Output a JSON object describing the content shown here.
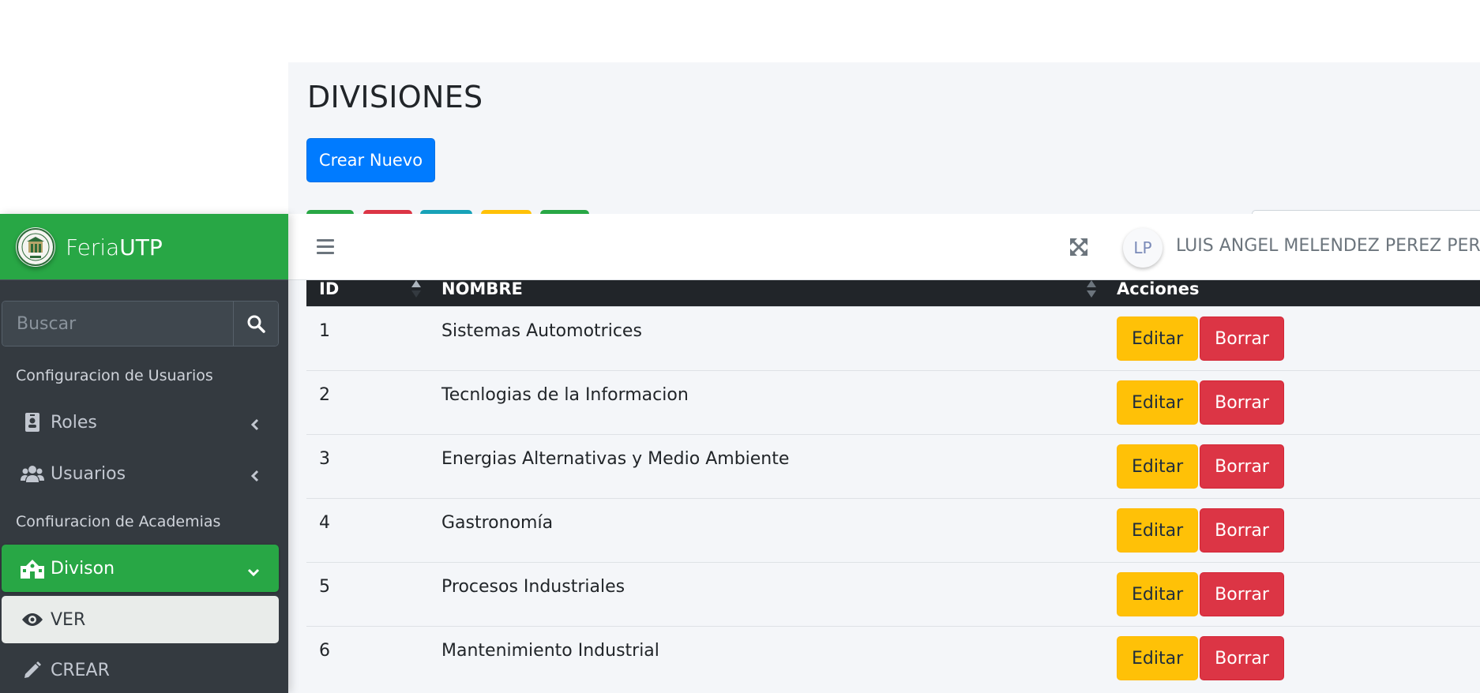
{
  "page": {
    "title": "DIVISIONES",
    "create_button": "Crear Nuevo"
  },
  "navbar": {
    "user_initials": "LP",
    "user_name": "LUIS ANGEL MELENDEZ PEREZ PEREZ"
  },
  "sidebar": {
    "brand_light": "Feria",
    "brand_bold": "UTP",
    "search_placeholder": "Buscar",
    "headers": [
      "Configuracion de Usuarios",
      "Confiuracion de Academias"
    ],
    "items": [
      {
        "label": "Roles",
        "icon": "id-badge-icon"
      },
      {
        "label": "Usuarios",
        "icon": "users-icon"
      },
      {
        "label": "Divison",
        "icon": "school-icon"
      },
      {
        "label": "VER",
        "icon": "eye-icon"
      },
      {
        "label": "CREAR",
        "icon": "pencil-icon"
      }
    ]
  },
  "table": {
    "columns": [
      "ID",
      "NOMBRE",
      "Acciones"
    ],
    "edit_label": "Editar",
    "delete_label": "Borrar",
    "rows": [
      {
        "id": "1",
        "nombre": "Sistemas Automotrices"
      },
      {
        "id": "2",
        "nombre": "Tecnlogias de la Informacion"
      },
      {
        "id": "3",
        "nombre": "Energias Alternativas y Medio Ambiente"
      },
      {
        "id": "4",
        "nombre": "Gastronomía"
      },
      {
        "id": "5",
        "nombre": "Procesos Industriales"
      },
      {
        "id": "6",
        "nombre": "Mantenimiento Industrial"
      }
    ]
  },
  "colors": {
    "primary": "#007bff",
    "success": "#28a745",
    "warning": "#ffc107",
    "danger": "#dc3545",
    "info": "#17a2b8",
    "sidebar_bg": "#343a40",
    "table_head": "#212529"
  }
}
